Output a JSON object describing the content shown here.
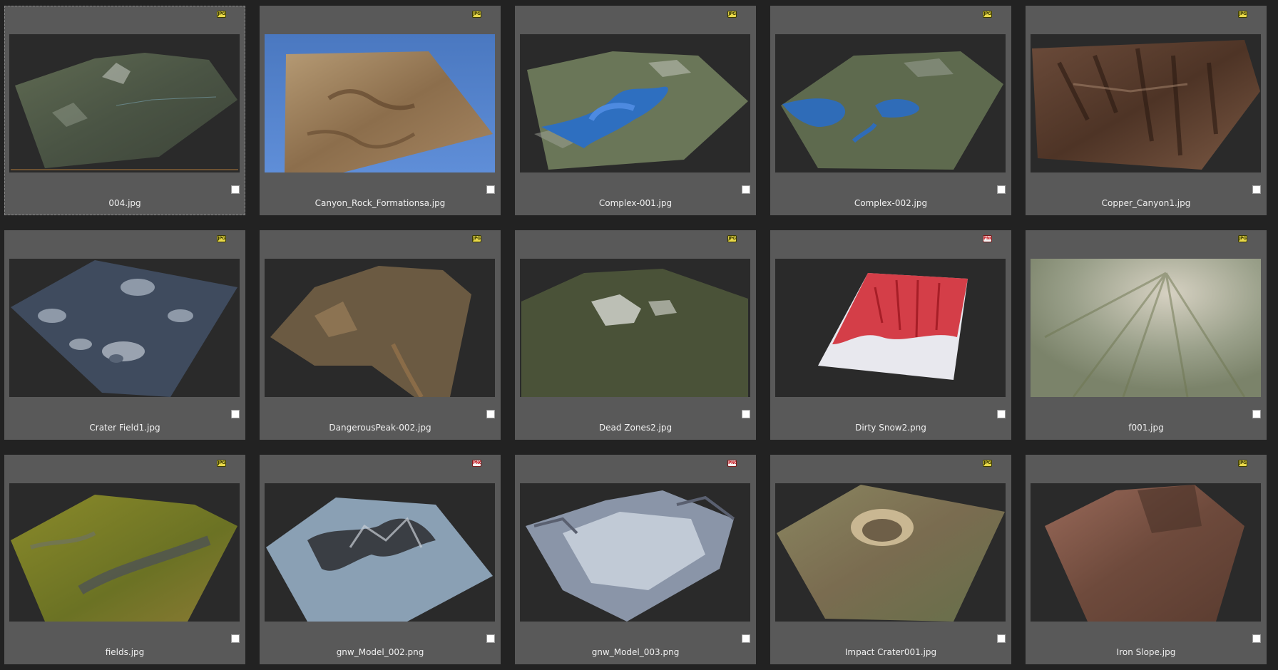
{
  "files": [
    {
      "name": "004.jpg",
      "type": "JPG",
      "checked": false,
      "selected": true
    },
    {
      "name": "Canyon_Rock_Formationsa.jpg",
      "type": "JPG",
      "checked": false
    },
    {
      "name": "Complex-001.jpg",
      "type": "JPG",
      "checked": false
    },
    {
      "name": "Complex-002.jpg",
      "type": "JPG",
      "checked": false
    },
    {
      "name": "Copper_Canyon1.jpg",
      "type": "JPG",
      "checked": false
    },
    {
      "name": "Crater Field1.jpg",
      "type": "JPG",
      "checked": false
    },
    {
      "name": "DangerousPeak-002.jpg",
      "type": "JPG",
      "checked": false
    },
    {
      "name": "Dead Zones2.jpg",
      "type": "JPG",
      "checked": false
    },
    {
      "name": "Dirty Snow2.png",
      "type": "PNG",
      "checked": false
    },
    {
      "name": "f001.jpg",
      "type": "JPG",
      "checked": false
    },
    {
      "name": "fields.jpg",
      "type": "JPG",
      "checked": false
    },
    {
      "name": "gnw_Model_002.png",
      "type": "PNG",
      "checked": false
    },
    {
      "name": "gnw_Model_003.png",
      "type": "PNG",
      "checked": false
    },
    {
      "name": "Impact Crater001.jpg",
      "type": "JPG",
      "checked": false
    },
    {
      "name": "Iron Slope.jpg",
      "type": "JPG",
      "checked": false
    }
  ],
  "colors": {
    "app_background": "#222222",
    "card_background": "#595959",
    "thumb_background": "#2a2a2a",
    "label_text": "#f0f0f0",
    "jpg_badge": "#e8d84a",
    "png_badge": "#c8161e"
  }
}
